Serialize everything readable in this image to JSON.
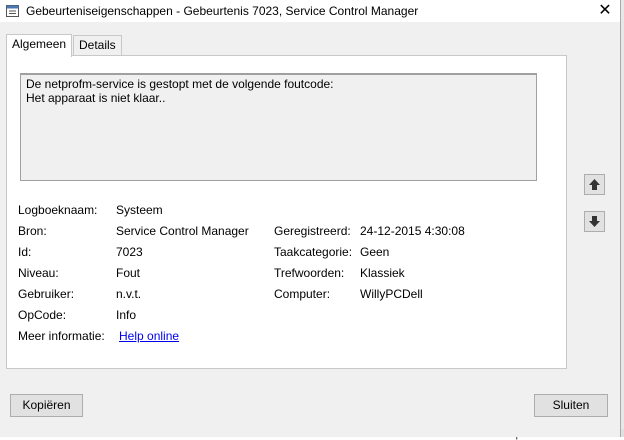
{
  "window": {
    "title": "Gebeurteniseigenschappen - Gebeurtenis 7023, Service Control Manager",
    "close_symbol": "✕"
  },
  "tabs": [
    {
      "label": "Algemeen",
      "active": true
    },
    {
      "label": "Details",
      "active": false
    }
  ],
  "description": {
    "line1": "De netprofm-service is gestopt met de volgende foutcode:",
    "line2": "Het apparaat is niet klaar.."
  },
  "fields": {
    "logboeknaam": {
      "label": "Logboeknaam:",
      "value": "Systeem"
    },
    "bron": {
      "label": "Bron:",
      "value": "Service Control Manager"
    },
    "id": {
      "label": "Id:",
      "value": "7023"
    },
    "niveau": {
      "label": "Niveau:",
      "value": "Fout"
    },
    "gebruiker": {
      "label": "Gebruiker:",
      "value": "n.v.t."
    },
    "opcode": {
      "label": "OpCode:",
      "value": "Info"
    },
    "meer_informatie": {
      "label": "Meer informatie:",
      "value": "Help online"
    },
    "geregistreerd": {
      "label": "Geregistreerd:",
      "value": "24-12-2015 4:30:08"
    },
    "taakcategorie": {
      "label": "Taakcategorie:",
      "value": "Geen"
    },
    "trefwoorden": {
      "label": "Trefwoorden:",
      "value": "Klassiek"
    },
    "computer": {
      "label": "Computer:",
      "value": "WillyPCDell"
    }
  },
  "buttons": {
    "copy": "Kopiëren",
    "close": "Sluiten"
  },
  "background": {
    "partial_text": "Kopiëren"
  },
  "icons": {
    "up_arrow": "arrow-up-icon",
    "down_arrow": "arrow-down-icon",
    "app": "event-viewer-icon"
  }
}
